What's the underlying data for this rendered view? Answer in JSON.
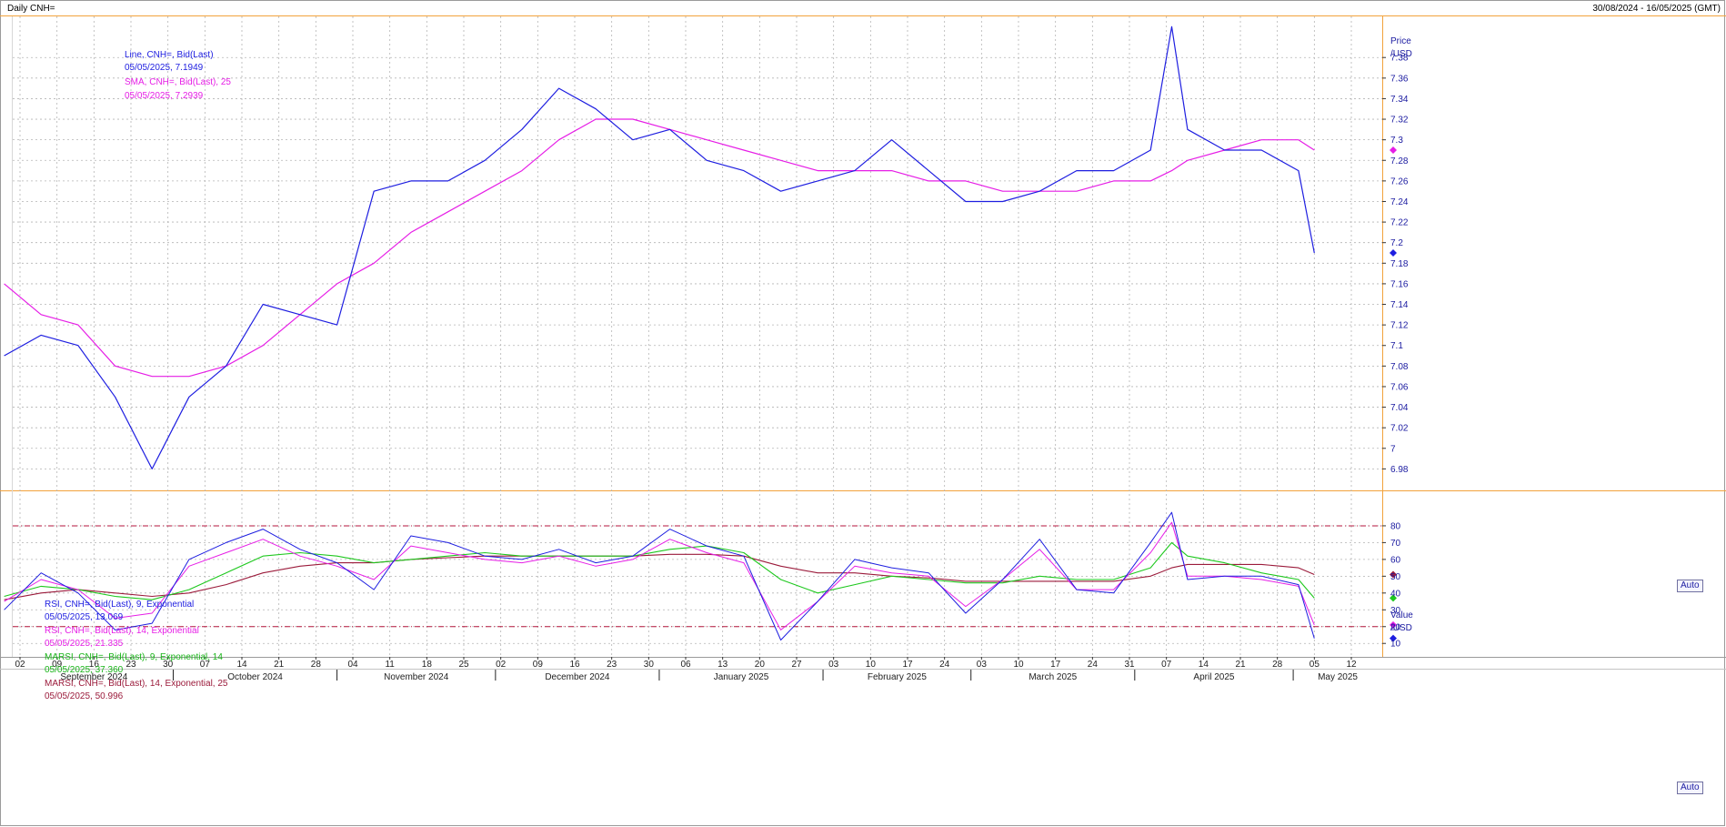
{
  "header": {
    "title": "Daily CNH=",
    "date_range": "30/08/2024 - 16/05/2025 (GMT)"
  },
  "colors": {
    "price_line": "#1e1ee0",
    "sma": "#e61ee6",
    "rsi9": "#1e1ee0",
    "rsi14": "#e61ee6",
    "marsi9": "#1ec81e",
    "marsi14": "#9b1b3b",
    "frame": "#f2a23c",
    "grid": "#b4b4b4"
  },
  "price_legend": {
    "line_label": "Line, CNH=, Bid(Last)",
    "line_value": "05/05/2025, 7.1949",
    "sma_label": "SMA, CNH=, Bid(Last),  25",
    "sma_value": "05/05/2025, 7.2939"
  },
  "price_axis": {
    "title1": "Price",
    "title2": "/USD",
    "auto_label": "Auto"
  },
  "indicator_legend": {
    "rsi9_label": "RSI, CNH=, Bid(Last),  9, Exponential",
    "rsi9_value": "05/05/2025, 13.069",
    "rsi14_label": "RSI, CNH=, Bid(Last),  14, Exponential",
    "rsi14_value": "05/05/2025, 21.335",
    "marsi9_label": "MARSI, CNH=, Bid(Last),  9, Exponential, 14",
    "marsi9_value": "05/05/2025, 37.360",
    "marsi14_label": "MARSI, CNH=, Bid(Last),  14, Exponential, 25",
    "marsi14_value": "05/05/2025, 50.996"
  },
  "indicator_axis": {
    "title1": "Value",
    "title2": "/USD",
    "auto_label": "Auto"
  },
  "chart_data": [
    {
      "type": "line",
      "title": "Daily CNH=",
      "ylabel": "Price /USD",
      "ylim": [
        6.96,
        7.42
      ],
      "yticks": [
        6.98,
        7.0,
        7.02,
        7.04,
        7.06,
        7.08,
        7.1,
        7.12,
        7.14,
        7.16,
        7.18,
        7.2,
        7.22,
        7.24,
        7.26,
        7.28,
        7.3,
        7.32,
        7.34,
        7.36,
        7.38
      ],
      "ytick_labels": [
        "6.98",
        "7",
        "7.02",
        "7.04",
        "7.06",
        "7.08",
        "7.1",
        "7.12",
        "7.14",
        "7.16",
        "7.18",
        "7.2",
        "7.22",
        "7.24",
        "7.26",
        "7.28",
        "7.3",
        "7.32",
        "7.34",
        "7.36",
        "7.38"
      ],
      "grid": true,
      "legend_position": "top-left",
      "x_dates": [
        "2024-08-30",
        "2024-09-06",
        "2024-09-13",
        "2024-09-20",
        "2024-09-27",
        "2024-10-04",
        "2024-10-11",
        "2024-10-18",
        "2024-10-25",
        "2024-11-01",
        "2024-11-08",
        "2024-11-15",
        "2024-11-22",
        "2024-11-29",
        "2024-12-06",
        "2024-12-13",
        "2024-12-20",
        "2024-12-27",
        "2025-01-03",
        "2025-01-10",
        "2025-01-17",
        "2025-01-24",
        "2025-01-31",
        "2025-02-07",
        "2025-02-14",
        "2025-02-21",
        "2025-02-28",
        "2025-03-07",
        "2025-03-14",
        "2025-03-21",
        "2025-03-28",
        "2025-04-04",
        "2025-04-08",
        "2025-04-11",
        "2025-04-18",
        "2025-04-25",
        "2025-05-02",
        "2025-05-05"
      ],
      "series": [
        {
          "name": "Line, CNH=, Bid(Last)",
          "values": [
            7.09,
            7.11,
            7.1,
            7.05,
            6.98,
            7.05,
            7.08,
            7.14,
            7.13,
            7.12,
            7.25,
            7.26,
            7.26,
            7.28,
            7.31,
            7.35,
            7.33,
            7.3,
            7.31,
            7.28,
            7.27,
            7.25,
            7.26,
            7.27,
            7.3,
            7.27,
            7.24,
            7.24,
            7.25,
            7.27,
            7.27,
            7.29,
            7.41,
            7.31,
            7.29,
            7.29,
            7.27,
            7.19
          ]
        },
        {
          "name": "SMA, CNH=, Bid(Last),  25",
          "values": [
            7.16,
            7.13,
            7.12,
            7.08,
            7.07,
            7.07,
            7.08,
            7.1,
            7.13,
            7.16,
            7.18,
            7.21,
            7.23,
            7.25,
            7.27,
            7.3,
            7.32,
            7.32,
            7.31,
            7.3,
            7.29,
            7.28,
            7.27,
            7.27,
            7.27,
            7.26,
            7.26,
            7.25,
            7.25,
            7.25,
            7.26,
            7.26,
            7.27,
            7.28,
            7.29,
            7.3,
            7.3,
            7.29
          ]
        }
      ]
    },
    {
      "type": "line",
      "ylabel": "Value /USD",
      "ylim": [
        2,
        100
      ],
      "yticks": [
        10,
        20,
        30,
        40,
        50,
        60,
        70,
        80
      ],
      "ytick_labels": [
        "10",
        "20",
        "30",
        "40",
        "50",
        "60",
        "70",
        "80"
      ],
      "grid": true,
      "legend_position": "top-left",
      "reference_lines": [
        80,
        20
      ],
      "x_dates": [
        "2024-08-30",
        "2024-09-06",
        "2024-09-13",
        "2024-09-20",
        "2024-09-27",
        "2024-10-04",
        "2024-10-11",
        "2024-10-18",
        "2024-10-25",
        "2024-11-01",
        "2024-11-08",
        "2024-11-15",
        "2024-11-22",
        "2024-11-29",
        "2024-12-06",
        "2024-12-13",
        "2024-12-20",
        "2024-12-27",
        "2025-01-03",
        "2025-01-10",
        "2025-01-17",
        "2025-01-24",
        "2025-01-31",
        "2025-02-07",
        "2025-02-14",
        "2025-02-21",
        "2025-02-28",
        "2025-03-07",
        "2025-03-14",
        "2025-03-21",
        "2025-03-28",
        "2025-04-04",
        "2025-04-08",
        "2025-04-11",
        "2025-04-18",
        "2025-04-25",
        "2025-05-02",
        "2025-05-05"
      ],
      "series": [
        {
          "name": "RSI, CNH=, Bid(Last),  9, Exponential",
          "values": [
            30,
            52,
            40,
            18,
            22,
            60,
            70,
            78,
            66,
            58,
            42,
            74,
            70,
            62,
            60,
            66,
            58,
            62,
            78,
            68,
            62,
            12,
            35,
            60,
            55,
            52,
            28,
            48,
            72,
            42,
            40,
            70,
            88,
            48,
            50,
            50,
            45,
            13
          ]
        },
        {
          "name": "RSI, CNH=, Bid(Last),  14, Exponential",
          "values": [
            35,
            48,
            42,
            25,
            28,
            56,
            64,
            72,
            62,
            56,
            48,
            68,
            64,
            60,
            58,
            62,
            56,
            60,
            72,
            64,
            58,
            18,
            35,
            56,
            52,
            50,
            32,
            48,
            66,
            42,
            42,
            64,
            82,
            50,
            50,
            48,
            44,
            21
          ]
        },
        {
          "name": "MARSI, CNH=, Bid(Last),  9, Exponential, 14",
          "values": [
            38,
            44,
            42,
            38,
            36,
            42,
            52,
            62,
            64,
            62,
            58,
            60,
            62,
            64,
            62,
            62,
            62,
            62,
            66,
            68,
            64,
            48,
            40,
            45,
            50,
            48,
            46,
            46,
            50,
            48,
            48,
            55,
            70,
            62,
            58,
            52,
            48,
            37
          ]
        },
        {
          "name": "MARSI, CNH=, Bid(Last),  14, Exponential, 25",
          "values": [
            36,
            40,
            42,
            40,
            38,
            40,
            45,
            52,
            56,
            58,
            58,
            60,
            61,
            62,
            62,
            62,
            62,
            62,
            63,
            63,
            62,
            56,
            52,
            52,
            50,
            49,
            47,
            47,
            47,
            47,
            47,
            50,
            55,
            57,
            57,
            57,
            55,
            51
          ]
        }
      ]
    }
  ],
  "x_axis": {
    "day_ticks": [
      "02",
      "09",
      "16",
      "23",
      "30",
      "07",
      "14",
      "21",
      "28",
      "04",
      "11",
      "18",
      "25",
      "02",
      "09",
      "16",
      "23",
      "30",
      "06",
      "13",
      "20",
      "27",
      "03",
      "10",
      "17",
      "24",
      "03",
      "10",
      "17",
      "24",
      "31",
      "07",
      "14",
      "21",
      "28",
      "05",
      "12"
    ],
    "month_labels": [
      "September 2024",
      "October 2024",
      "November 2024",
      "December 2024",
      "January 2025",
      "February 2025",
      "March 2025",
      "April 2025",
      "May 2025"
    ]
  }
}
